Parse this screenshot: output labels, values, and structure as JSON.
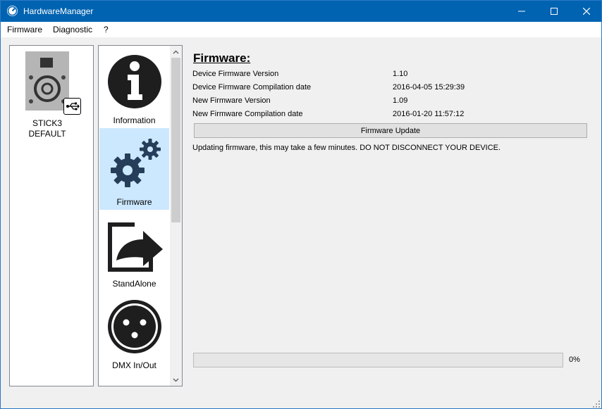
{
  "window": {
    "title": "HardwareManager",
    "icon": "gauge-icon",
    "controls": {
      "minimize": "minimize-icon",
      "maximize": "maximize-icon",
      "close": "close-icon"
    }
  },
  "menu": {
    "items": [
      "Firmware",
      "Diagnostic",
      "?"
    ]
  },
  "device": {
    "name_line1": "STICK3",
    "name_line2": "DEFAULT",
    "icon": "speaker-device-icon",
    "connection_icon": "usb-icon"
  },
  "nav": {
    "items": [
      {
        "label": "Information",
        "icon": "information-icon",
        "selected": false
      },
      {
        "label": "Firmware",
        "icon": "gears-icon",
        "selected": true
      },
      {
        "label": "StandAlone",
        "icon": "export-arrow-icon",
        "selected": false
      },
      {
        "label": "DMX In/Out",
        "icon": "xlr-connector-icon",
        "selected": false
      }
    ],
    "accent_color": "#cce8ff"
  },
  "firmware": {
    "title": "Firmware:",
    "rows": [
      {
        "label": "Device Firmware Version",
        "value": "1.10"
      },
      {
        "label": "Device Firmware Compilation date",
        "value": "2016-04-05 15:29:39"
      },
      {
        "label": "New Firmware Version",
        "value": "1.09"
      },
      {
        "label": "New Firmware Compilation date",
        "value": "2016-01-20 11:57:12"
      }
    ],
    "update_button": "Firmware Update",
    "message": "Updating firmware, this may take a few minutes. DO NOT DISCONNECT YOUR DEVICE."
  },
  "progress": {
    "percent": 0,
    "text": "0%"
  },
  "colors": {
    "titlebar": "#0063b1",
    "window_bg": "#f0f0f0",
    "icon_dark": "#1e1e1e",
    "gear_blue": "#263e5a"
  }
}
